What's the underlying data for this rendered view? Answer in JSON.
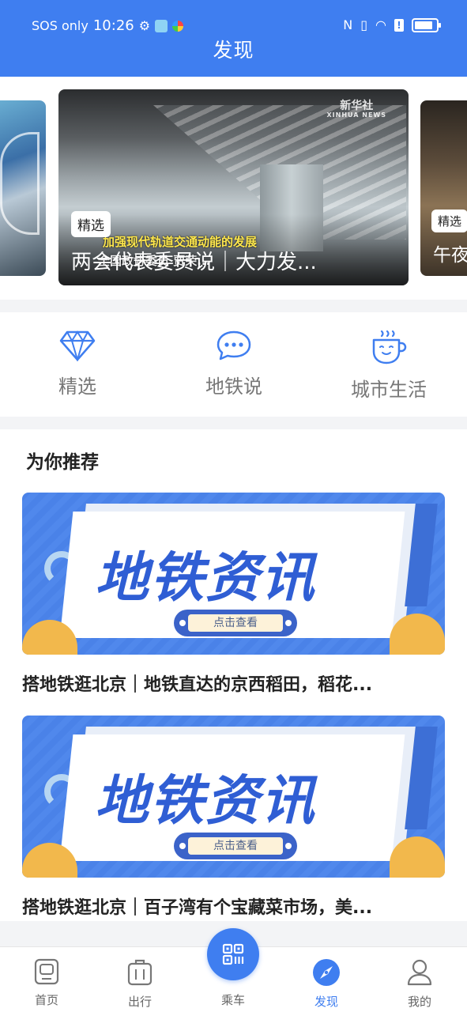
{
  "status_bar": {
    "carrier": "SOS only",
    "time": "10:26"
  },
  "header": {
    "title": "发现"
  },
  "carousel": {
    "main": {
      "tag": "精选",
      "title": "两会代表委员说｜大力发...",
      "caption_yellow": "加强现代轨道交通动能的发展",
      "caption_white": "全国政协委员 贾荣...",
      "watermark": "新华社",
      "watermark_sub": "XINHUA NEWS"
    },
    "right": {
      "tag": "精选",
      "title": "午夜"
    }
  },
  "categories": [
    {
      "label": "精选",
      "icon": "diamond-icon"
    },
    {
      "label": "地铁说",
      "icon": "chat-bubble-icon"
    },
    {
      "label": "城市生活",
      "icon": "coffee-cup-icon"
    }
  ],
  "recommend": {
    "title": "为你推荐",
    "cards": [
      {
        "banner_text": "地铁资讯",
        "banner_button": "点击查看",
        "title": "搭地铁逛北京｜地铁直达的京西稻田，稻花..."
      },
      {
        "banner_text": "地铁资讯",
        "banner_button": "点击查看",
        "title": "搭地铁逛北京｜百子湾有个宝藏菜市场，美..."
      }
    ]
  },
  "bottom_nav": {
    "items": [
      {
        "label": "首页",
        "icon": "home-screen-icon"
      },
      {
        "label": "出行",
        "icon": "luggage-icon"
      },
      {
        "label": "乘车",
        "icon": "qr-code-icon"
      },
      {
        "label": "发现",
        "icon": "discover-icon",
        "active": true
      },
      {
        "label": "我的",
        "icon": "user-icon"
      }
    ]
  },
  "colors": {
    "primary": "#3f7ef0",
    "banner_blue": "#2f5ed4",
    "accent_yellow": "#f2b84c"
  }
}
